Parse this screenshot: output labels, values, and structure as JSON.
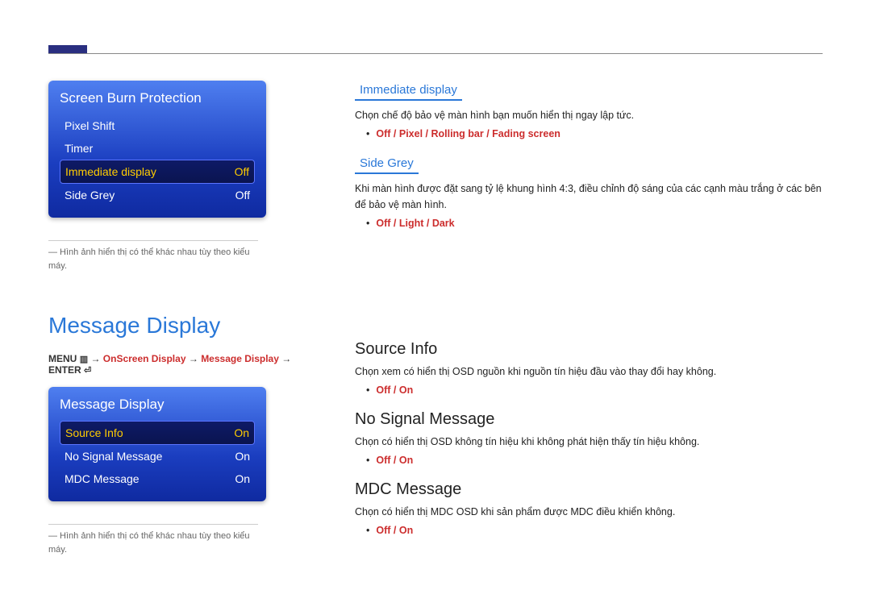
{
  "osd1": {
    "title": "Screen Burn Protection",
    "rows": [
      {
        "label": "Pixel Shift",
        "value": "",
        "highlight": false
      },
      {
        "label": "Timer",
        "value": "",
        "highlight": false
      },
      {
        "label": "Immediate display",
        "value": "Off",
        "highlight": true
      },
      {
        "label": "Side Grey",
        "value": "Off",
        "highlight": false
      }
    ],
    "footnote": "― Hình ảnh hiển thị có thể khác nhau tùy theo kiểu máy."
  },
  "right_top": {
    "immediate": {
      "heading": "Immediate display",
      "desc": "Chọn chế độ bảo vệ màn hình bạn muốn hiển thị ngay lập tức.",
      "options": "Off / Pixel / Rolling bar / Fading screen"
    },
    "sidegrey": {
      "heading": "Side Grey",
      "desc": "Khi màn hình được đặt sang tỷ lệ khung hình 4:3, điều chỉnh độ sáng của các cạnh màu trắng ở các bên để bảo vệ màn hình.",
      "options": "Off / Light / Dark"
    }
  },
  "section2": {
    "title": "Message Display",
    "nav_menu": "MENU",
    "nav_icon1": "▥",
    "nav_arrow": "→",
    "nav_path1": "OnScreen Display",
    "nav_path2": "Message Display",
    "nav_enter": "ENTER",
    "nav_icon2": "⏎"
  },
  "osd2": {
    "title": "Message Display",
    "rows": [
      {
        "label": "Source Info",
        "value": "On",
        "highlight": true
      },
      {
        "label": "No Signal Message",
        "value": "On",
        "highlight": false
      },
      {
        "label": "MDC Message",
        "value": "On",
        "highlight": false
      }
    ],
    "footnote": "― Hình ảnh hiển thị có thể khác nhau tùy theo kiểu máy."
  },
  "right_bottom": {
    "source": {
      "heading": "Source Info",
      "desc": "Chọn xem có hiển thị OSD nguồn khi nguồn tín hiệu đầu vào thay đổi hay không.",
      "options": "Off / On"
    },
    "nosignal": {
      "heading": "No Signal Message",
      "desc": "Chọn có hiển thị OSD không tín hiệu khi không phát hiện thấy tín hiệu không.",
      "options": "Off / On"
    },
    "mdc": {
      "heading": "MDC Message",
      "desc": "Chọn có hiển thị MDC OSD khi sản phẩm được MDC điều khiển không.",
      "options": "Off / On"
    }
  }
}
